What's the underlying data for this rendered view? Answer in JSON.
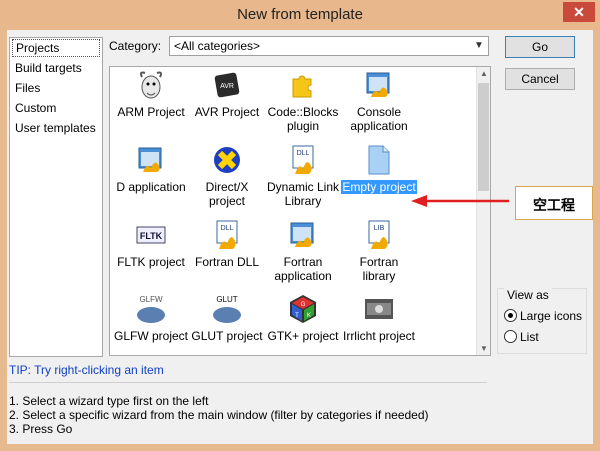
{
  "window": {
    "title": "New from template",
    "close_glyph": "✕"
  },
  "sidebar": {
    "items": [
      "Projects",
      "Build targets",
      "Files",
      "Custom",
      "User templates"
    ],
    "selected": "Projects"
  },
  "category": {
    "label": "Category:",
    "value": "<All categories>"
  },
  "buttons": {
    "go": "Go",
    "cancel": "Cancel"
  },
  "templates": [
    {
      "label": "ARM Project",
      "icon": "gnu-icon"
    },
    {
      "label": "AVR Project",
      "icon": "avr-chip-icon"
    },
    {
      "label": "Code::Blocks plugin",
      "icon": "puzzle-icon"
    },
    {
      "label": "Console application",
      "icon": "console-app-icon"
    },
    {
      "label": "D application",
      "icon": "app-icon"
    },
    {
      "label": "Direct/X project",
      "icon": "directx-icon"
    },
    {
      "label": "Dynamic Link Library",
      "icon": "dll-icon"
    },
    {
      "label": "Empty project",
      "icon": "blank-page-icon",
      "selected": true
    },
    {
      "label": "FLTK project",
      "icon": "fltk-icon"
    },
    {
      "label": "Fortran DLL",
      "icon": "dll-icon"
    },
    {
      "label": "Fortran application",
      "icon": "app-icon"
    },
    {
      "label": "Fortran library",
      "icon": "lib-icon"
    },
    {
      "label": "GLFW project",
      "icon": "glfw-icon"
    },
    {
      "label": "GLUT project",
      "icon": "glut-icon"
    },
    {
      "label": "GTK+ project",
      "icon": "gtk-icon"
    },
    {
      "label": "Irrlicht project",
      "icon": "irrlicht-icon"
    }
  ],
  "icon_text": {
    "avr": "AVR",
    "dll": "DLL",
    "lib": "LIB",
    "fltk": "FLTK",
    "glfw": "GLFW",
    "glut": "GLUT",
    "gtk_g": "G",
    "gtk_t": "T",
    "gtk_k": "K"
  },
  "tip": "TIP: Try right-clicking an item",
  "instructions": [
    "1. Select a wizard type first on the left",
    "2. Select a specific wizard from the main window (filter by categories if needed)",
    "3. Press Go"
  ],
  "view_as": {
    "caption": "View as",
    "options": [
      "Large icons",
      "List"
    ],
    "selected": "Large icons"
  },
  "annotation": {
    "text": "空工程",
    "arrow_color": "#e02020"
  }
}
